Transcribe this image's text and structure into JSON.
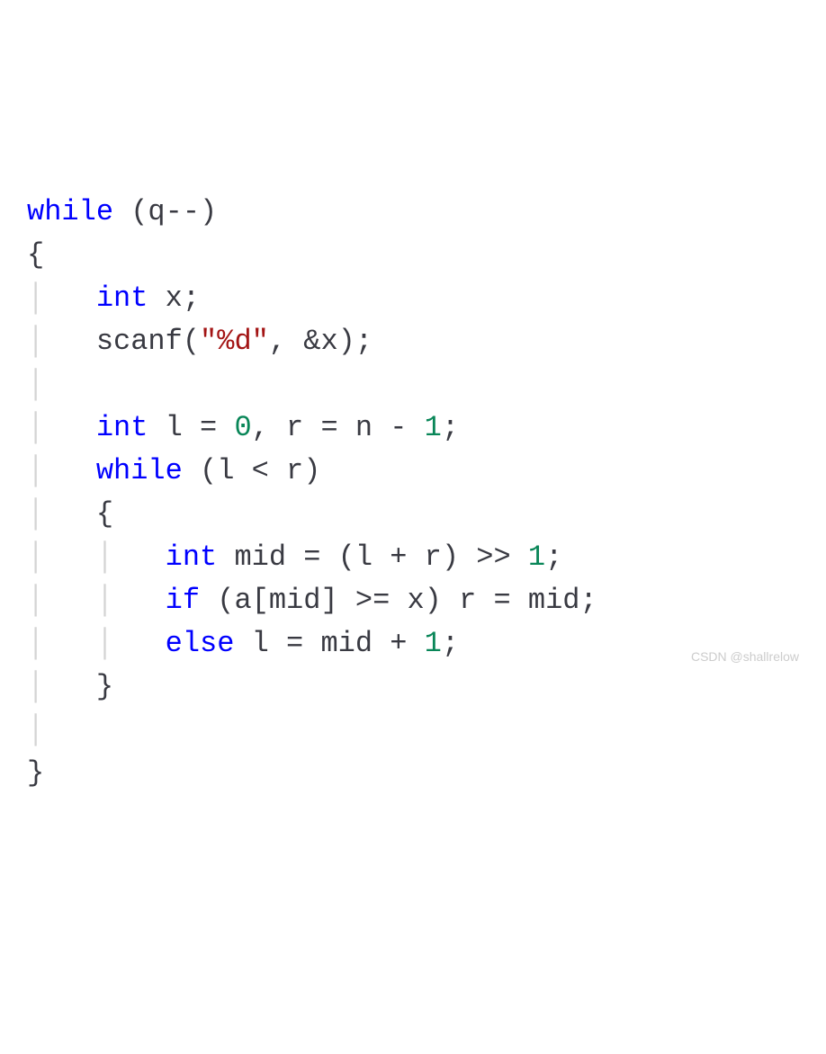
{
  "code": {
    "tokens": [
      {
        "type": "keyword",
        "text": "while"
      },
      {
        "type": "plain",
        "text": " (q"
      },
      {
        "type": "operator",
        "text": "--"
      },
      {
        "type": "plain",
        "text": ")"
      },
      {
        "type": "newline"
      },
      {
        "type": "plain",
        "text": "{"
      },
      {
        "type": "newline"
      },
      {
        "type": "guide",
        "text": "│   "
      },
      {
        "type": "type",
        "text": "int"
      },
      {
        "type": "plain",
        "text": " x;"
      },
      {
        "type": "newline"
      },
      {
        "type": "guide",
        "text": "│   "
      },
      {
        "type": "plain",
        "text": "scanf("
      },
      {
        "type": "string",
        "text": "\"%d\""
      },
      {
        "type": "plain",
        "text": ", &x);"
      },
      {
        "type": "newline"
      },
      {
        "type": "guide",
        "text": "│"
      },
      {
        "type": "newline"
      },
      {
        "type": "guide",
        "text": "│   "
      },
      {
        "type": "type",
        "text": "int"
      },
      {
        "type": "plain",
        "text": " l = "
      },
      {
        "type": "number",
        "text": "0"
      },
      {
        "type": "plain",
        "text": ", r = n - "
      },
      {
        "type": "number",
        "text": "1"
      },
      {
        "type": "plain",
        "text": ";"
      },
      {
        "type": "newline"
      },
      {
        "type": "guide",
        "text": "│   "
      },
      {
        "type": "keyword",
        "text": "while"
      },
      {
        "type": "plain",
        "text": " (l < r)"
      },
      {
        "type": "newline"
      },
      {
        "type": "guide",
        "text": "│   "
      },
      {
        "type": "plain",
        "text": "{"
      },
      {
        "type": "newline"
      },
      {
        "type": "guide",
        "text": "│   │   "
      },
      {
        "type": "type",
        "text": "int"
      },
      {
        "type": "plain",
        "text": " mid = (l + r) >> "
      },
      {
        "type": "number",
        "text": "1"
      },
      {
        "type": "plain",
        "text": ";"
      },
      {
        "type": "newline"
      },
      {
        "type": "guide",
        "text": "│   │   "
      },
      {
        "type": "keyword",
        "text": "if"
      },
      {
        "type": "plain",
        "text": " (a[mid] >= x) r = mid;"
      },
      {
        "type": "newline"
      },
      {
        "type": "guide",
        "text": "│   │   "
      },
      {
        "type": "keyword",
        "text": "else"
      },
      {
        "type": "plain",
        "text": " l = mid + "
      },
      {
        "type": "number",
        "text": "1"
      },
      {
        "type": "plain",
        "text": ";"
      },
      {
        "type": "newline"
      },
      {
        "type": "guide",
        "text": "│   "
      },
      {
        "type": "plain",
        "text": "}"
      },
      {
        "type": "newline"
      },
      {
        "type": "guide",
        "text": "│"
      },
      {
        "type": "newline"
      },
      {
        "type": "plain",
        "text": "}"
      }
    ]
  },
  "watermark": "CSDN @shallrelow"
}
